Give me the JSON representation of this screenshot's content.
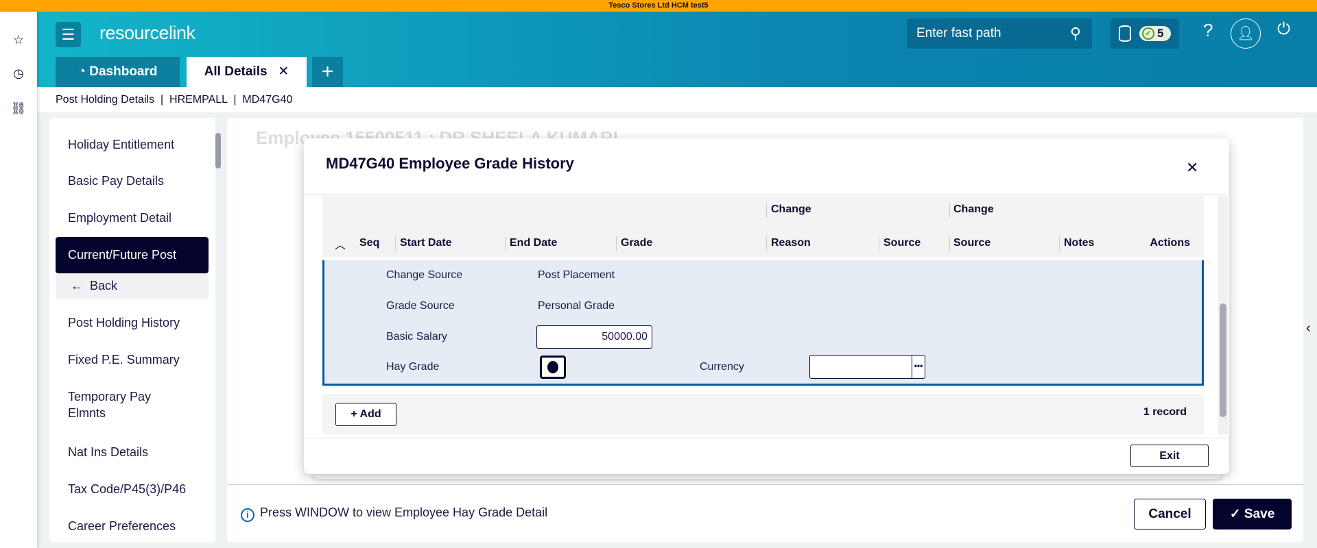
{
  "environment": "Tesco Stores Ltd HCM test5",
  "header": {
    "logo_a": "resource",
    "logo_b": "link",
    "fast_path_placeholder": "Enter fast path",
    "badge_count": "5",
    "help": "?"
  },
  "tabs": [
    {
      "label": "Dashboard"
    },
    {
      "label": "All Details",
      "close": "✕"
    },
    {
      "label": "+"
    }
  ],
  "breadcrumb": "Post Holding Details  |  HREMPALL  |  MD47G40",
  "nav": {
    "items": [
      "Holiday Entitlement",
      "Basic Pay Details",
      "Employment Detail",
      "Current/Future Post",
      "Back",
      "Post Holding History",
      "Fixed P.E. Summary",
      "Temporary Pay",
      "Elmnts",
      "Nat Ins Details",
      "Tax Code/P45(3)/P46",
      "Career Preferences"
    ]
  },
  "background_title": "Employee 15500511 : DR SHEELA KUMARI",
  "modal": {
    "title": "MD47G40 Employee Grade History",
    "columns_top": [
      "Change",
      "Change"
    ],
    "columns": [
      "Seq",
      "Start Date",
      "End Date",
      "Grade",
      "Reason",
      "Source",
      "Source",
      "Notes",
      "Actions"
    ],
    "detail": {
      "change_source_label": "Change Source",
      "change_source_value": "Post Placement",
      "grade_source_label": "Grade Source",
      "grade_source_value": "Personal Grade",
      "basic_salary_label": "Basic Salary",
      "basic_salary_value": "50000.00",
      "hay_grade_label": "Hay Grade",
      "currency_label": "Currency",
      "currency_value": ""
    },
    "add_label": "Add",
    "record_count": "1 record",
    "exit_label": "Exit"
  },
  "footer": {
    "info": "Press WINDOW to view Employee Hay Grade Detail",
    "cancel": "Cancel",
    "save": "Save"
  }
}
